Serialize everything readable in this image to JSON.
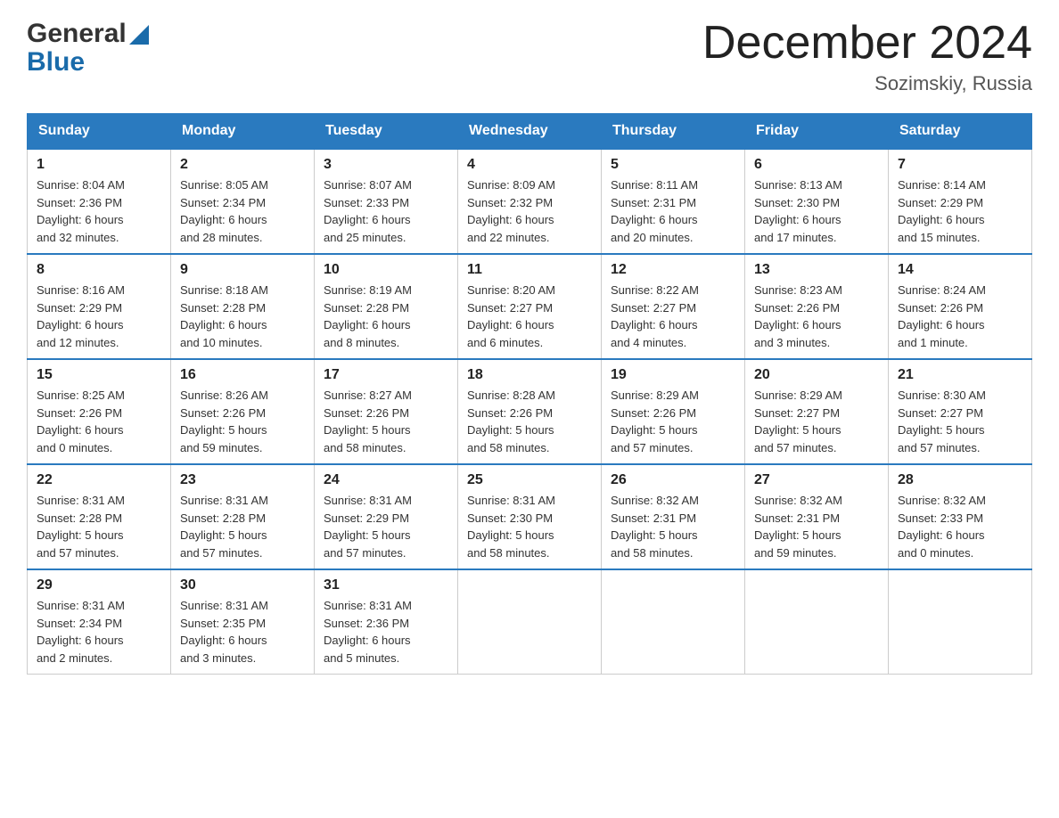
{
  "header": {
    "title": "December 2024",
    "subtitle": "Sozimskiy, Russia"
  },
  "days_of_week": [
    "Sunday",
    "Monday",
    "Tuesday",
    "Wednesday",
    "Thursday",
    "Friday",
    "Saturday"
  ],
  "weeks": [
    [
      {
        "day": "1",
        "info": "Sunrise: 8:04 AM\nSunset: 2:36 PM\nDaylight: 6 hours\nand 32 minutes."
      },
      {
        "day": "2",
        "info": "Sunrise: 8:05 AM\nSunset: 2:34 PM\nDaylight: 6 hours\nand 28 minutes."
      },
      {
        "day": "3",
        "info": "Sunrise: 8:07 AM\nSunset: 2:33 PM\nDaylight: 6 hours\nand 25 minutes."
      },
      {
        "day": "4",
        "info": "Sunrise: 8:09 AM\nSunset: 2:32 PM\nDaylight: 6 hours\nand 22 minutes."
      },
      {
        "day": "5",
        "info": "Sunrise: 8:11 AM\nSunset: 2:31 PM\nDaylight: 6 hours\nand 20 minutes."
      },
      {
        "day": "6",
        "info": "Sunrise: 8:13 AM\nSunset: 2:30 PM\nDaylight: 6 hours\nand 17 minutes."
      },
      {
        "day": "7",
        "info": "Sunrise: 8:14 AM\nSunset: 2:29 PM\nDaylight: 6 hours\nand 15 minutes."
      }
    ],
    [
      {
        "day": "8",
        "info": "Sunrise: 8:16 AM\nSunset: 2:29 PM\nDaylight: 6 hours\nand 12 minutes."
      },
      {
        "day": "9",
        "info": "Sunrise: 8:18 AM\nSunset: 2:28 PM\nDaylight: 6 hours\nand 10 minutes."
      },
      {
        "day": "10",
        "info": "Sunrise: 8:19 AM\nSunset: 2:28 PM\nDaylight: 6 hours\nand 8 minutes."
      },
      {
        "day": "11",
        "info": "Sunrise: 8:20 AM\nSunset: 2:27 PM\nDaylight: 6 hours\nand 6 minutes."
      },
      {
        "day": "12",
        "info": "Sunrise: 8:22 AM\nSunset: 2:27 PM\nDaylight: 6 hours\nand 4 minutes."
      },
      {
        "day": "13",
        "info": "Sunrise: 8:23 AM\nSunset: 2:26 PM\nDaylight: 6 hours\nand 3 minutes."
      },
      {
        "day": "14",
        "info": "Sunrise: 8:24 AM\nSunset: 2:26 PM\nDaylight: 6 hours\nand 1 minute."
      }
    ],
    [
      {
        "day": "15",
        "info": "Sunrise: 8:25 AM\nSunset: 2:26 PM\nDaylight: 6 hours\nand 0 minutes."
      },
      {
        "day": "16",
        "info": "Sunrise: 8:26 AM\nSunset: 2:26 PM\nDaylight: 5 hours\nand 59 minutes."
      },
      {
        "day": "17",
        "info": "Sunrise: 8:27 AM\nSunset: 2:26 PM\nDaylight: 5 hours\nand 58 minutes."
      },
      {
        "day": "18",
        "info": "Sunrise: 8:28 AM\nSunset: 2:26 PM\nDaylight: 5 hours\nand 58 minutes."
      },
      {
        "day": "19",
        "info": "Sunrise: 8:29 AM\nSunset: 2:26 PM\nDaylight: 5 hours\nand 57 minutes."
      },
      {
        "day": "20",
        "info": "Sunrise: 8:29 AM\nSunset: 2:27 PM\nDaylight: 5 hours\nand 57 minutes."
      },
      {
        "day": "21",
        "info": "Sunrise: 8:30 AM\nSunset: 2:27 PM\nDaylight: 5 hours\nand 57 minutes."
      }
    ],
    [
      {
        "day": "22",
        "info": "Sunrise: 8:31 AM\nSunset: 2:28 PM\nDaylight: 5 hours\nand 57 minutes."
      },
      {
        "day": "23",
        "info": "Sunrise: 8:31 AM\nSunset: 2:28 PM\nDaylight: 5 hours\nand 57 minutes."
      },
      {
        "day": "24",
        "info": "Sunrise: 8:31 AM\nSunset: 2:29 PM\nDaylight: 5 hours\nand 57 minutes."
      },
      {
        "day": "25",
        "info": "Sunrise: 8:31 AM\nSunset: 2:30 PM\nDaylight: 5 hours\nand 58 minutes."
      },
      {
        "day": "26",
        "info": "Sunrise: 8:32 AM\nSunset: 2:31 PM\nDaylight: 5 hours\nand 58 minutes."
      },
      {
        "day": "27",
        "info": "Sunrise: 8:32 AM\nSunset: 2:31 PM\nDaylight: 5 hours\nand 59 minutes."
      },
      {
        "day": "28",
        "info": "Sunrise: 8:32 AM\nSunset: 2:33 PM\nDaylight: 6 hours\nand 0 minutes."
      }
    ],
    [
      {
        "day": "29",
        "info": "Sunrise: 8:31 AM\nSunset: 2:34 PM\nDaylight: 6 hours\nand 2 minutes."
      },
      {
        "day": "30",
        "info": "Sunrise: 8:31 AM\nSunset: 2:35 PM\nDaylight: 6 hours\nand 3 minutes."
      },
      {
        "day": "31",
        "info": "Sunrise: 8:31 AM\nSunset: 2:36 PM\nDaylight: 6 hours\nand 5 minutes."
      },
      {
        "day": "",
        "info": ""
      },
      {
        "day": "",
        "info": ""
      },
      {
        "day": "",
        "info": ""
      },
      {
        "day": "",
        "info": ""
      }
    ]
  ]
}
